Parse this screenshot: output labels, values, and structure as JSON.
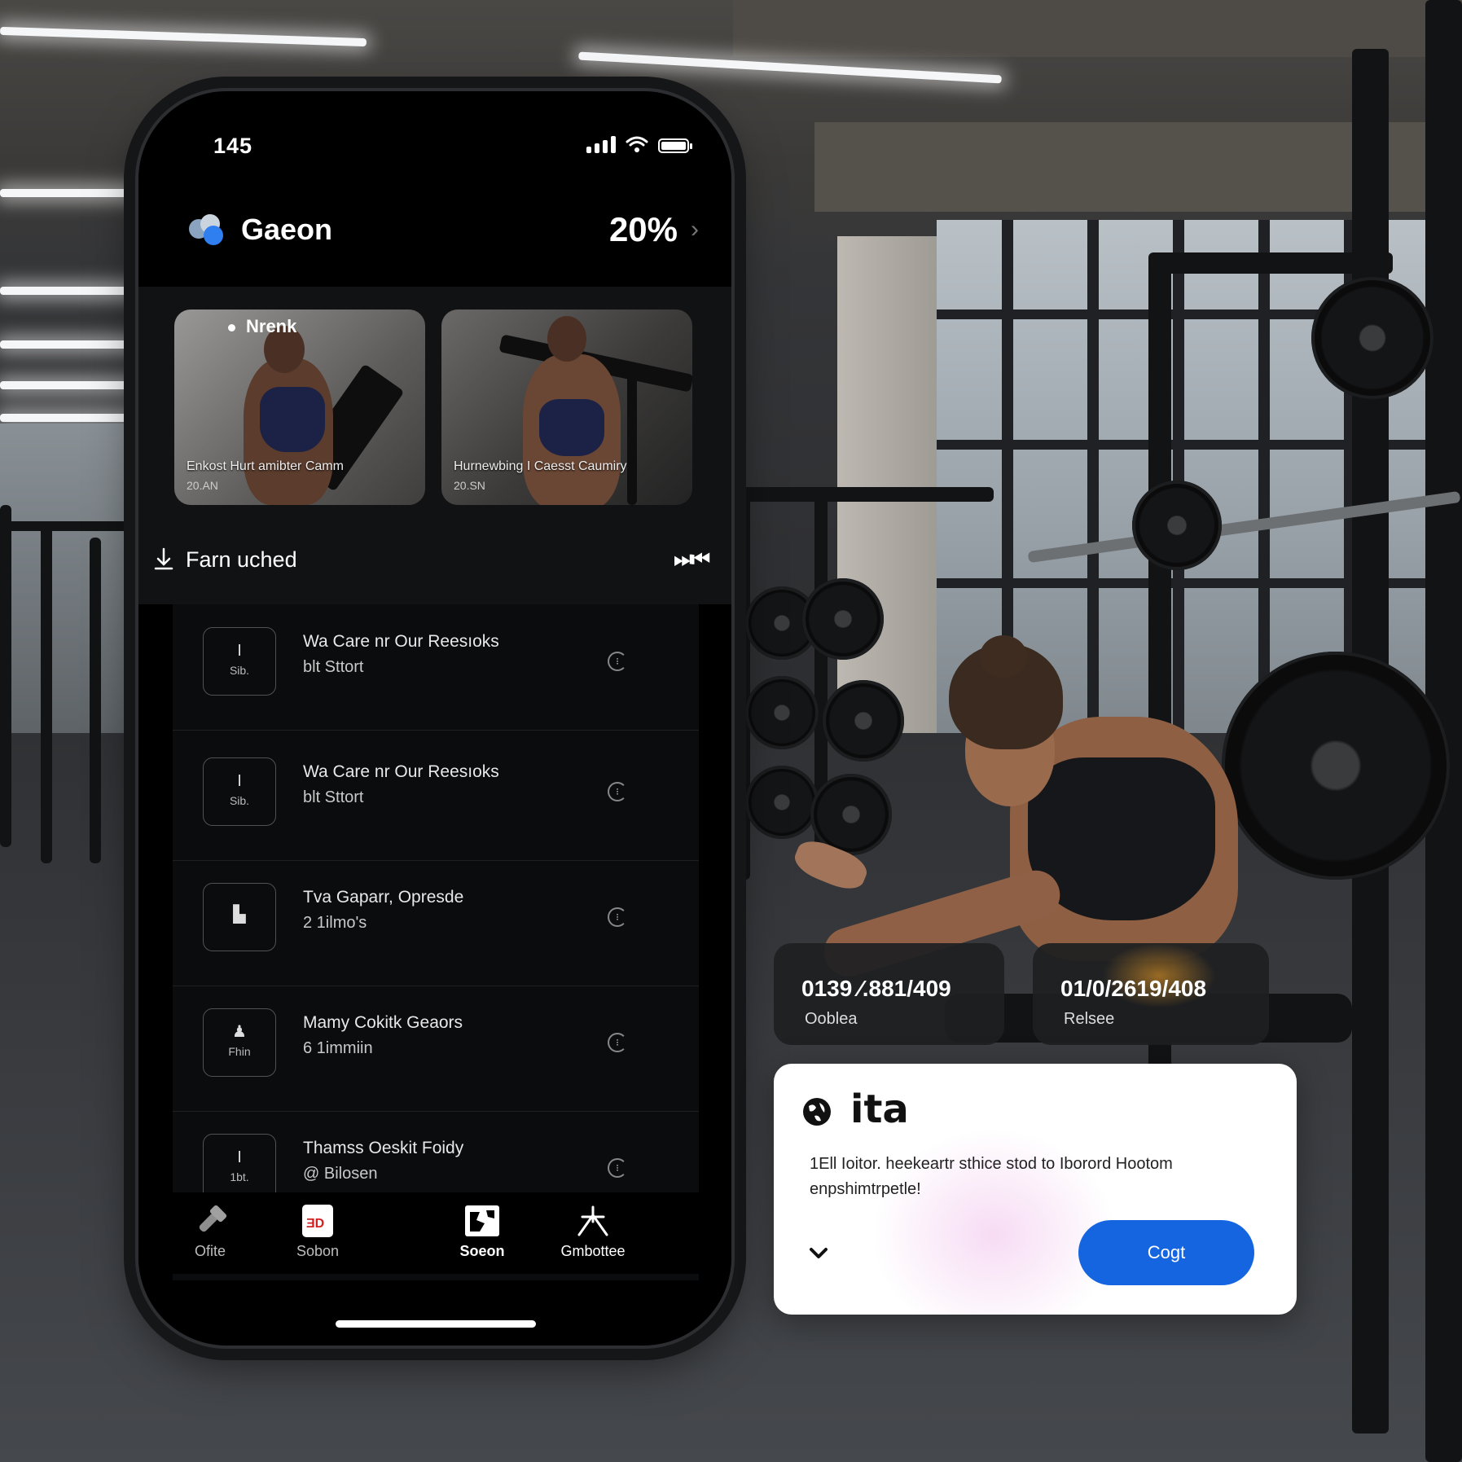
{
  "status_bar": {
    "time": "145"
  },
  "header": {
    "title": "Gaeon",
    "percent": "20%"
  },
  "featured": [
    {
      "tag": "Nrenk",
      "caption": "Enkost Hurt amibter Camm",
      "meta": "20.AN"
    },
    {
      "tag": "",
      "caption": "Hurnewbing I Caesst Caumiry",
      "meta": "20.SN"
    }
  ],
  "section": {
    "title": "Farn uched",
    "action": "⏭⏮"
  },
  "list": [
    {
      "thumb_glyph": "I",
      "thumb_code": "Sib.",
      "title": "Wa Care nr Our Reesıoks",
      "sub": "blt Sttort"
    },
    {
      "thumb_glyph": "I",
      "thumb_code": "Sib.",
      "title": "Wa Care nr Our Reesıoks",
      "sub": "blt Sttort"
    },
    {
      "thumb_glyph": "▙",
      "thumb_code": "",
      "title": "Tva Gaparr, Opresde",
      "sub": "2  1ilmo's"
    },
    {
      "thumb_glyph": "♟",
      "thumb_code": "Fhin",
      "title": "Mamy Cokitk Geaors",
      "sub": "6  1immiin"
    },
    {
      "thumb_glyph": "I",
      "thumb_code": "1bt.",
      "title": "Thamss Oeskit Foidy",
      "sub": "@  Bilosen"
    }
  ],
  "tabs": [
    {
      "label": "Ofite",
      "icon": "dumbbell-icon"
    },
    {
      "label": "Sobon",
      "icon": "app-badge-icon"
    },
    {
      "label": "Soeon",
      "icon": "puzzle-icon"
    },
    {
      "label": "Gmbottee",
      "icon": "tripod-icon"
    }
  ],
  "stats": [
    {
      "value": "0139 ⁄.881/409",
      "label": "Ooblea"
    },
    {
      "value": "01/0/2619/408",
      "label": "Relsee"
    }
  ],
  "dialog": {
    "title": "ita",
    "body": "1Ell Ioitor. heekeartr sthice stod to Iborord Hootom enpshimtrpetle!",
    "button": "Cogt"
  },
  "colors": {
    "accent": "#1565e0",
    "dark_bg": "#000000",
    "card_bg": "#1e1f21",
    "glow": "#ffaa28"
  }
}
